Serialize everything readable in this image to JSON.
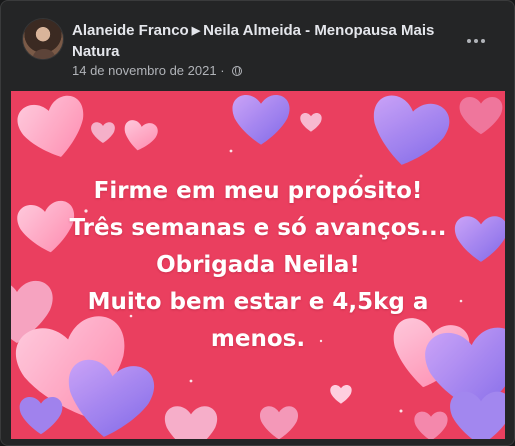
{
  "post": {
    "author": "Alaneide Franco",
    "target": "Neila Almeida - Menopausa Mais Natura",
    "date": "14 de novembro de 2021",
    "audience_icon": "globe-icon",
    "menu_icon": "more-options-icon"
  },
  "image": {
    "background_color": "#ea3f5f",
    "caption_lines": [
      "Firme em meu propósito!",
      "Três semanas e só avanços...",
      "Obrigada Neila!",
      "Muito bem estar e 4,5kg a",
      "menos."
    ]
  }
}
